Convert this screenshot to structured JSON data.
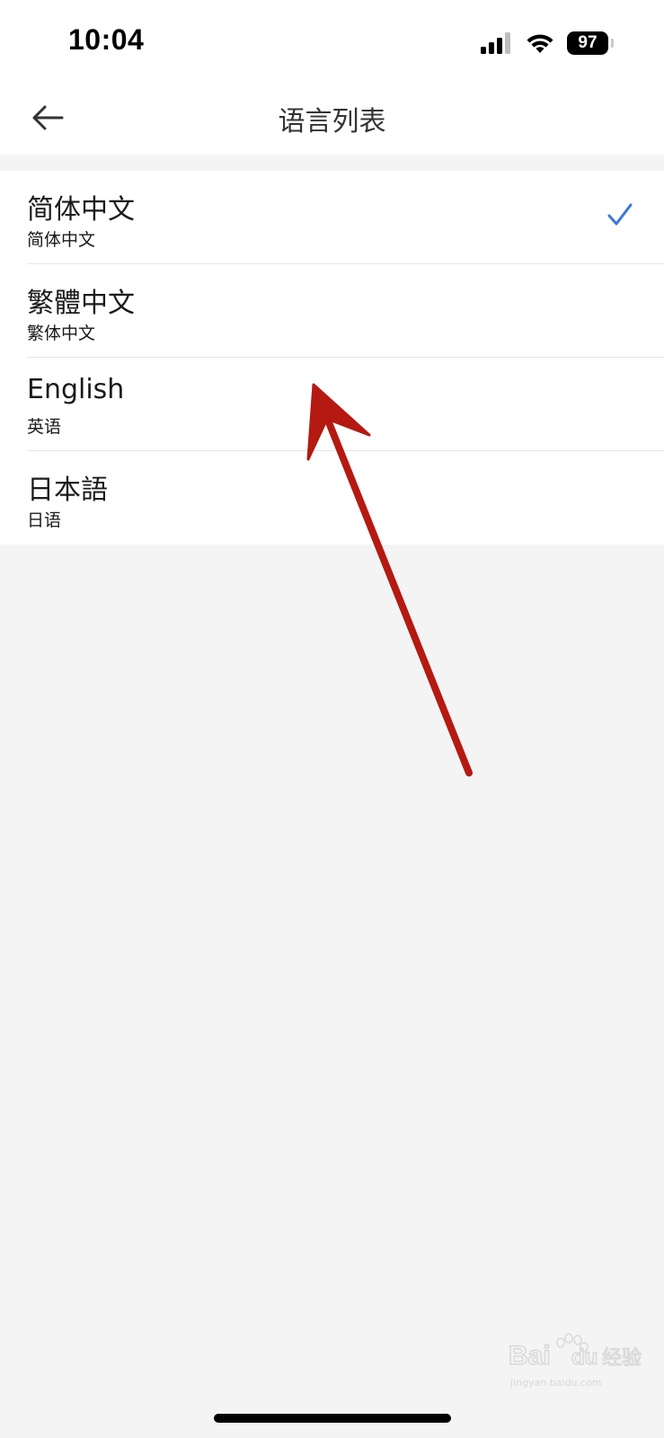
{
  "status_bar": {
    "time": "10:04",
    "battery_level": "97",
    "icons": [
      "cellular-signal-icon",
      "wifi-icon",
      "battery-icon"
    ]
  },
  "nav": {
    "title": "语言列表",
    "back_icon": "arrow-left-icon"
  },
  "languages": [
    {
      "title": "简体中文",
      "subtitle": "简体中文",
      "selected": true
    },
    {
      "title": "繁體中文",
      "subtitle": "繁体中文",
      "selected": false
    },
    {
      "title": "English",
      "subtitle": "英语",
      "selected": false
    },
    {
      "title": "日本語",
      "subtitle": "日语",
      "selected": false
    }
  ],
  "colors": {
    "accent": "#3a78d6",
    "annotation_arrow": "#b41a12",
    "background": "#f4f4f4"
  },
  "watermark": {
    "brand": "Baidu",
    "text": "经验",
    "url": "jingyan.baidu.com"
  }
}
